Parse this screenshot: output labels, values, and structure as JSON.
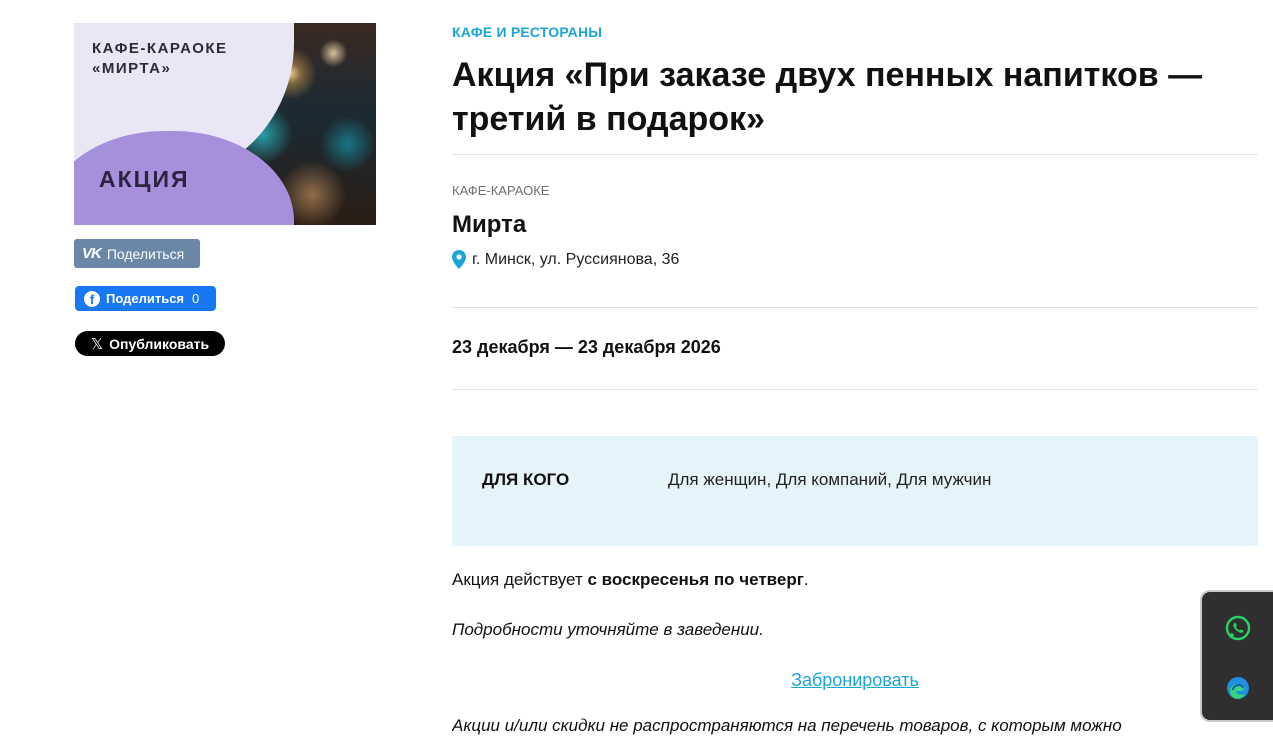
{
  "image": {
    "brand_text": "КАФЕ-КАРАОКЕ\n«МИРТА»",
    "badge_text": "АКЦИЯ"
  },
  "share": {
    "vk_label": "Поделиться",
    "fb_label": "Поделиться",
    "fb_count": "0",
    "x_label": "Опубликовать"
  },
  "article": {
    "category": "КАФЕ И РЕСТОРАНЫ",
    "title": "Акция «При заказе двух пенных напитков — третий в подарок»",
    "venue_type": "КАФЕ-КАРАОКЕ",
    "venue_name": "Мирта",
    "address": "г. Минск, ул. Руссиянова, 36",
    "dates": "23 декабря — 23 декабря 2026",
    "target_label": "ДЛЯ КОГО",
    "target_value": "Для женщин, Для компаний, Для мужчин",
    "text_prefix": "Акция действует ",
    "text_bold": "с воскресенья по четверг",
    "text_suffix": ".",
    "details": "Подробности уточняйте в заведении.",
    "book_link": "Забронировать",
    "cutoff_text": "Акции и/или скидки не распространяются на перечень товаров, с которым можно"
  },
  "colors": {
    "accent": "#1aa5d6",
    "box_bg": "#e4f4fa",
    "vk": "#6b87a8",
    "fb": "#1877f2"
  },
  "icons": {
    "pin": "location-pin-icon",
    "whatsapp": "whatsapp-icon",
    "edge": "browser-icon"
  }
}
